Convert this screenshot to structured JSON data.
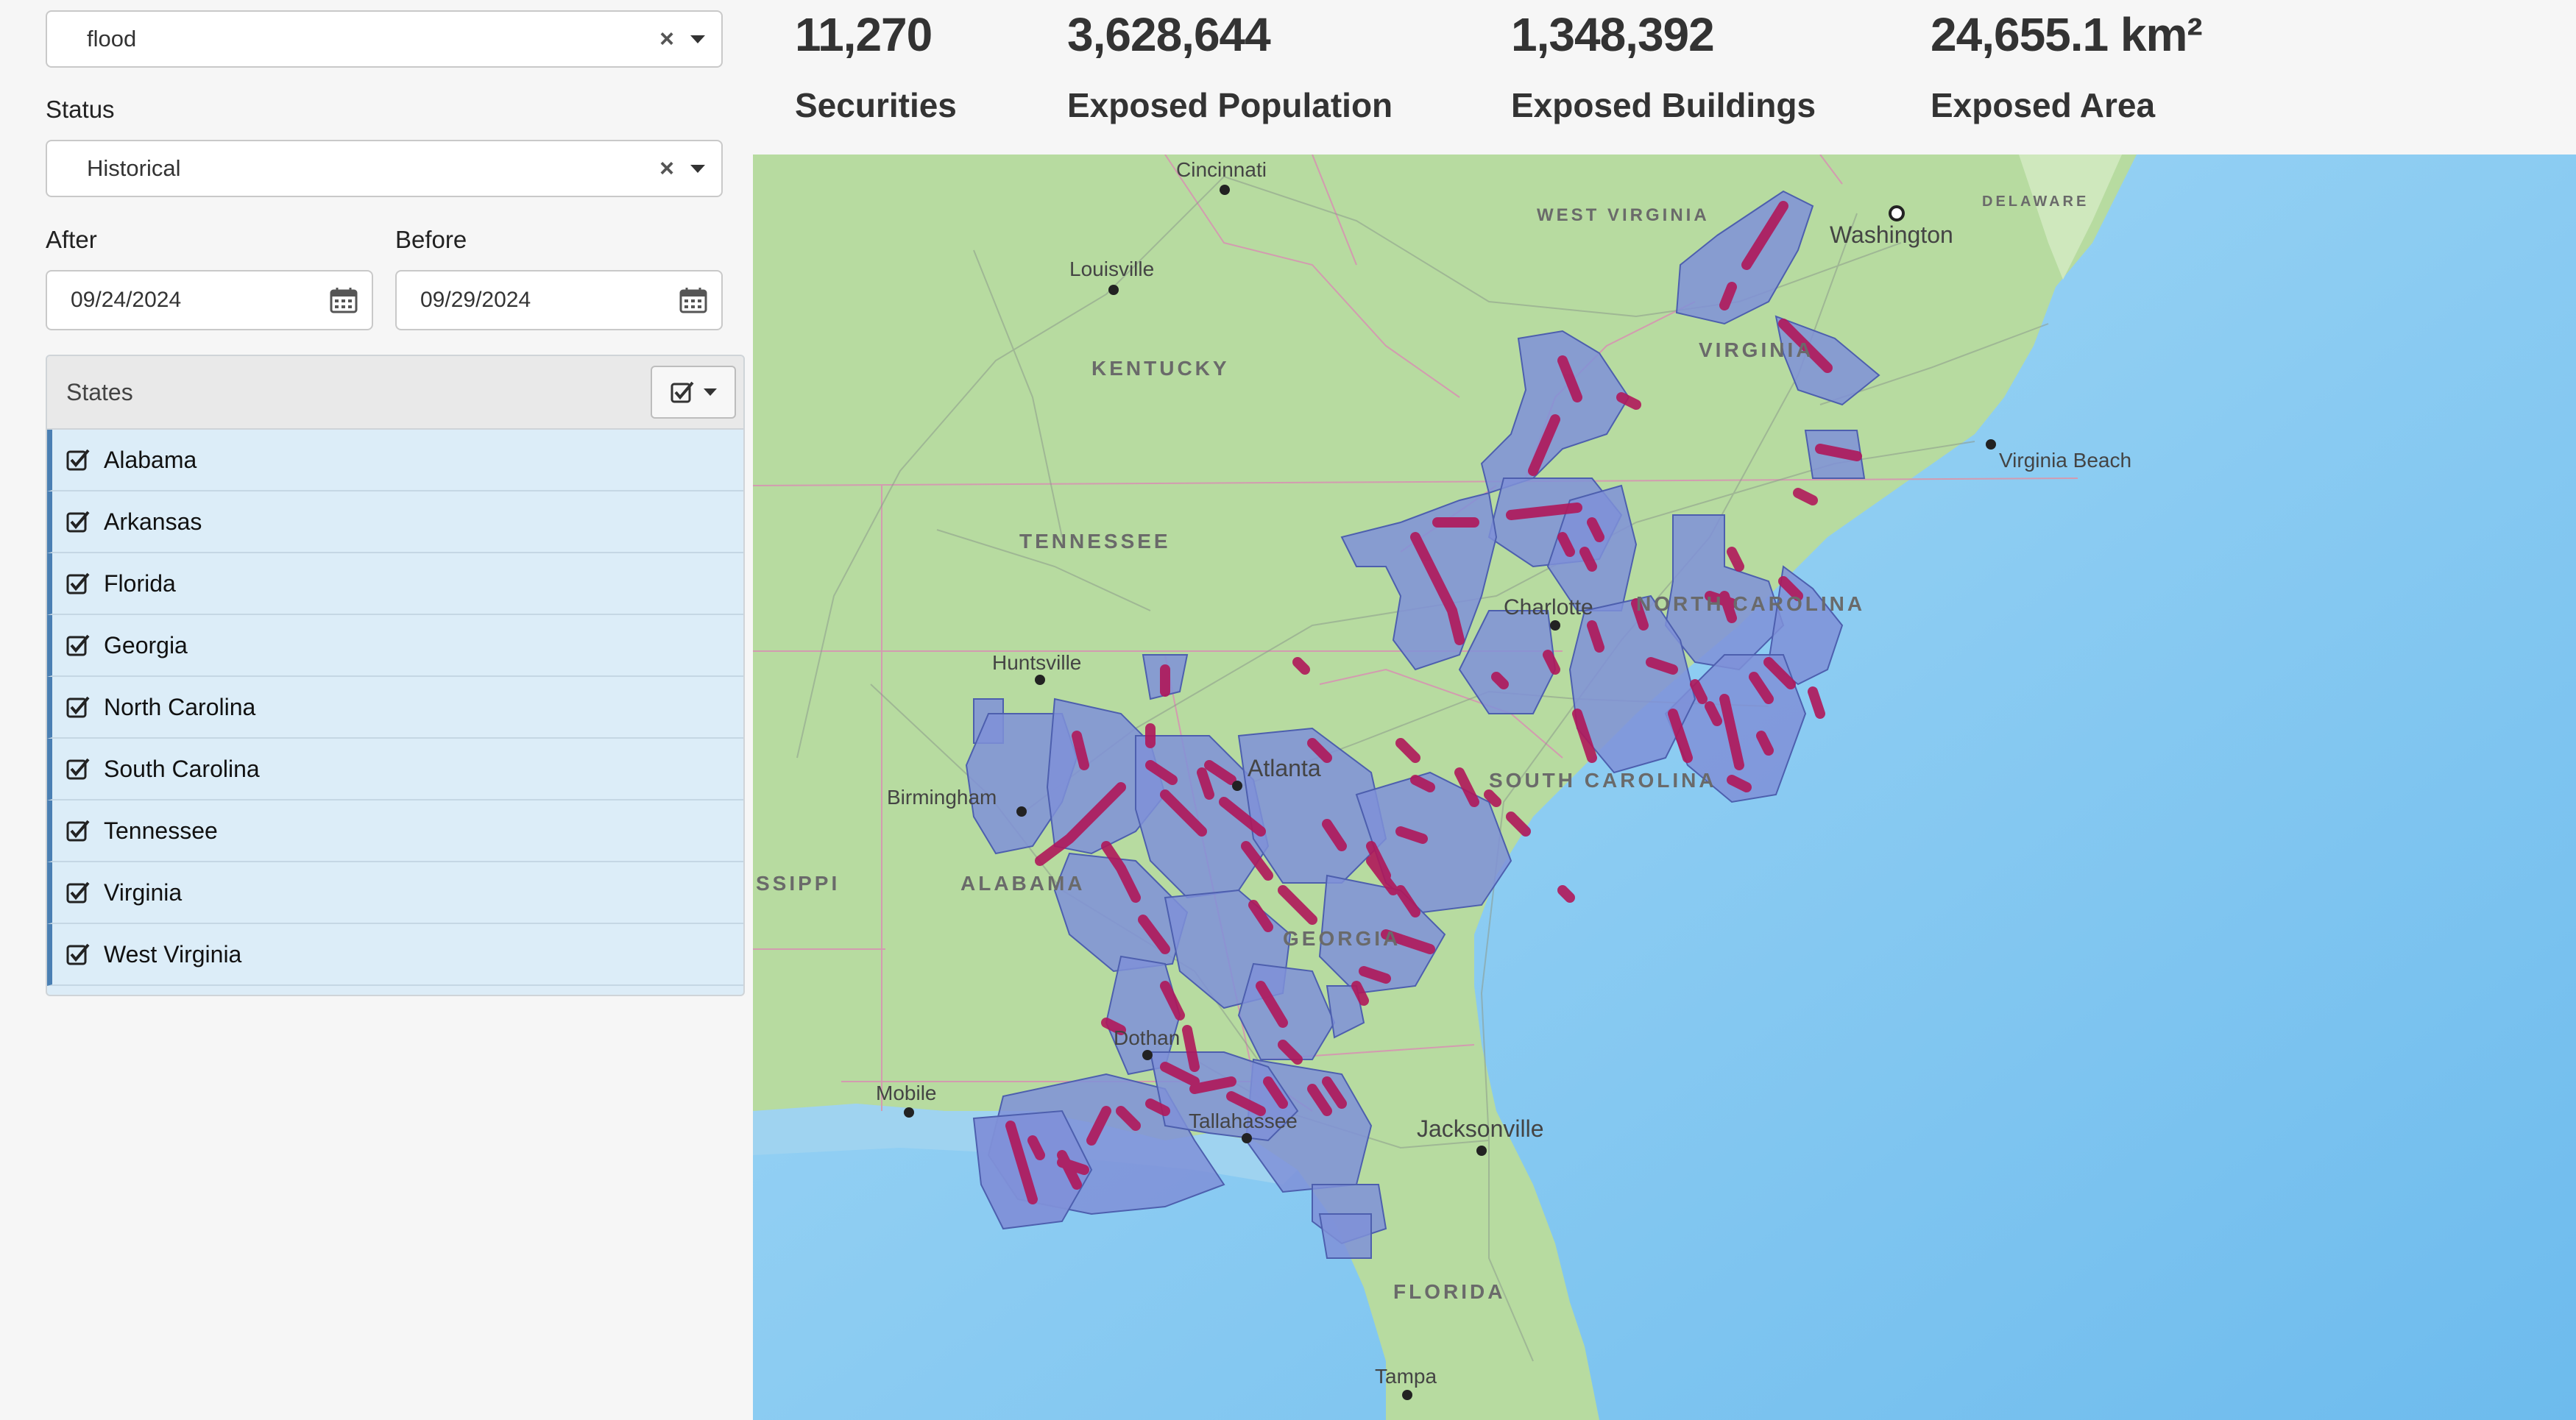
{
  "filters": {
    "hazard": {
      "value": "flood"
    },
    "status": {
      "label": "Status",
      "value": "Historical"
    },
    "after": {
      "label": "After",
      "value": "09/24/2024"
    },
    "before": {
      "label": "Before",
      "value": "09/29/2024"
    }
  },
  "states_panel": {
    "title": "States",
    "items": [
      {
        "label": "Alabama",
        "checked": true
      },
      {
        "label": "Arkansas",
        "checked": true
      },
      {
        "label": "Florida",
        "checked": true
      },
      {
        "label": "Georgia",
        "checked": true
      },
      {
        "label": "North Carolina",
        "checked": true
      },
      {
        "label": "South Carolina",
        "checked": true
      },
      {
        "label": "Tennessee",
        "checked": true
      },
      {
        "label": "Virginia",
        "checked": true
      },
      {
        "label": "West Virginia",
        "checked": true
      }
    ]
  },
  "kpis": [
    {
      "value": "11,270",
      "label": "Securities"
    },
    {
      "value": "3,628,644",
      "label": "Exposed Population"
    },
    {
      "value": "1,348,392",
      "label": "Exposed Buildings"
    },
    {
      "value": "24,655.1 km²",
      "label": "Exposed Area"
    }
  ],
  "map": {
    "cities": [
      "Cincinnati",
      "Louisville",
      "Washington",
      "Virginia Beach",
      "Charlotte",
      "Huntsville",
      "Atlanta",
      "Birmingham",
      "Dothan",
      "Mobile",
      "Tallahassee",
      "Jacksonville",
      "Tampa"
    ],
    "states": [
      "WEST VIRGINIA",
      "KENTUCKY",
      "VIRGINIA",
      "TENNESSEE",
      "NORTH CAROLINA",
      "SOUTH CAROLINA",
      "ALABAMA",
      "GEORGIA",
      "FLORIDA",
      "DELAWARE",
      "SSIPPI"
    ],
    "colors": {
      "land": "#b9dca0",
      "water": "#7fc3ee",
      "exposure_fill": "#7b8fd6",
      "flood_band": "#b0185a"
    }
  }
}
